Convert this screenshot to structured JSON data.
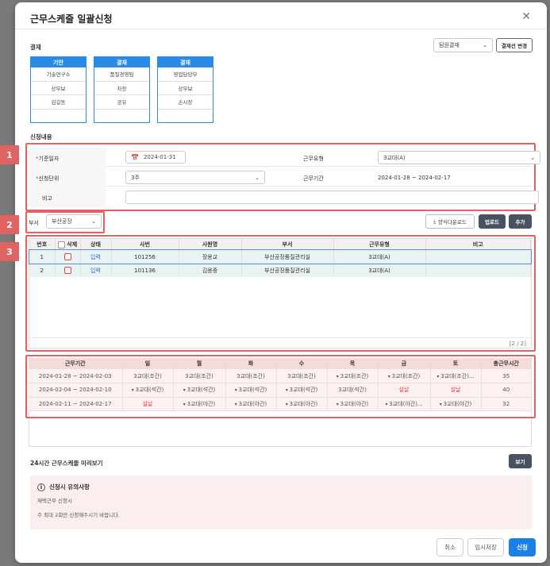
{
  "title": "근무스케줄 일괄신청",
  "approval": {
    "label": "결재",
    "select_value": "팀원결재",
    "change_btn": "결재선 변경",
    "boxes": [
      {
        "head": "기안",
        "rows": [
          "기술연구소",
          "상무보",
          "김길동",
          ""
        ]
      },
      {
        "head": "결재",
        "rows": [
          "품질경영팀",
          "차장",
          "공유",
          ""
        ]
      },
      {
        "head": "결재",
        "rows": [
          "영업담당부",
          "상무보",
          "손시장",
          ""
        ]
      }
    ]
  },
  "request": {
    "label": "신청내용",
    "base_date_label": "기준일자",
    "base_date_value": "2024-01-31",
    "work_type_label": "근무유형",
    "work_type_value": "3교대(A)",
    "unit_label": "신청단위",
    "unit_value": "3주",
    "period_label": "근무기간",
    "period_value": "2024-01-28 ~ 2024-02-17",
    "note_label": "비고",
    "required_mark": "*"
  },
  "badges": [
    "1",
    "2",
    "3"
  ],
  "dept": {
    "label": "부서",
    "value": "부산공장",
    "download_btn": "양식다운로드",
    "upload_btn": "업로드",
    "add_btn": "추가"
  },
  "employees": {
    "headers": [
      "번호",
      "삭제",
      "상태",
      "사번",
      "사원명",
      "부서",
      "근무유형",
      "비고"
    ],
    "rows": [
      {
        "no": "1",
        "status": "입력",
        "id": "101256",
        "name": "장용교",
        "dept": "부산공장품질관리실",
        "type": "3교대(A)",
        "note": ""
      },
      {
        "no": "2",
        "status": "입력",
        "id": "101136",
        "name": "김용중",
        "dept": "부산공장품질관리실",
        "type": "3교대(A)",
        "note": ""
      }
    ],
    "paging": "[2 / 2]"
  },
  "schedule": {
    "headers": [
      "근무기간",
      "일",
      "월",
      "화",
      "수",
      "목",
      "금",
      "토",
      "총근무시간"
    ],
    "rows": [
      {
        "period": "2024-01-28 ~ 2024-02-03",
        "days": [
          "3교대(조간)",
          "3교대(조간)",
          "3교대(조간)",
          "3교대(조간)",
          "3교대(조간)",
          "3교대(조간)",
          "3교대(조간)..."
        ],
        "dd": [
          false,
          false,
          false,
          false,
          true,
          true,
          true
        ],
        "hol": [
          false,
          false,
          false,
          false,
          false,
          false,
          false
        ],
        "total": "35"
      },
      {
        "period": "2024-02-04 ~ 2024-02-10",
        "days": [
          "3교대(석간)",
          "3교대(석간)",
          "3교대(석간)",
          "3교대(석간)",
          "3교대(석간)",
          "설날",
          "설날"
        ],
        "dd": [
          true,
          true,
          true,
          true,
          false,
          false,
          false
        ],
        "hol": [
          false,
          false,
          false,
          false,
          false,
          true,
          true
        ],
        "total": "40"
      },
      {
        "period": "2024-02-11 ~ 2024-02-17",
        "days": [
          "설날",
          "3교대(야간)",
          "3교대(야간)",
          "3교대(야간)",
          "3교대(야간)",
          "3교대(야간)...",
          "3교대(야간)"
        ],
        "dd": [
          false,
          true,
          true,
          true,
          true,
          true,
          true
        ],
        "hol": [
          true,
          false,
          false,
          false,
          false,
          false,
          false
        ],
        "total": "32"
      }
    ]
  },
  "preview": {
    "label": "24시간 근무스케줄 미리보기",
    "btn": "보기"
  },
  "notice": {
    "title": "신청시 유의사항",
    "line1": "재택근무 신청시",
    "line2": "주 최대 2회만 신청해주시기 바랍니다."
  },
  "footer": {
    "cancel": "취소",
    "temp_save": "임시저장",
    "submit": "신청"
  }
}
